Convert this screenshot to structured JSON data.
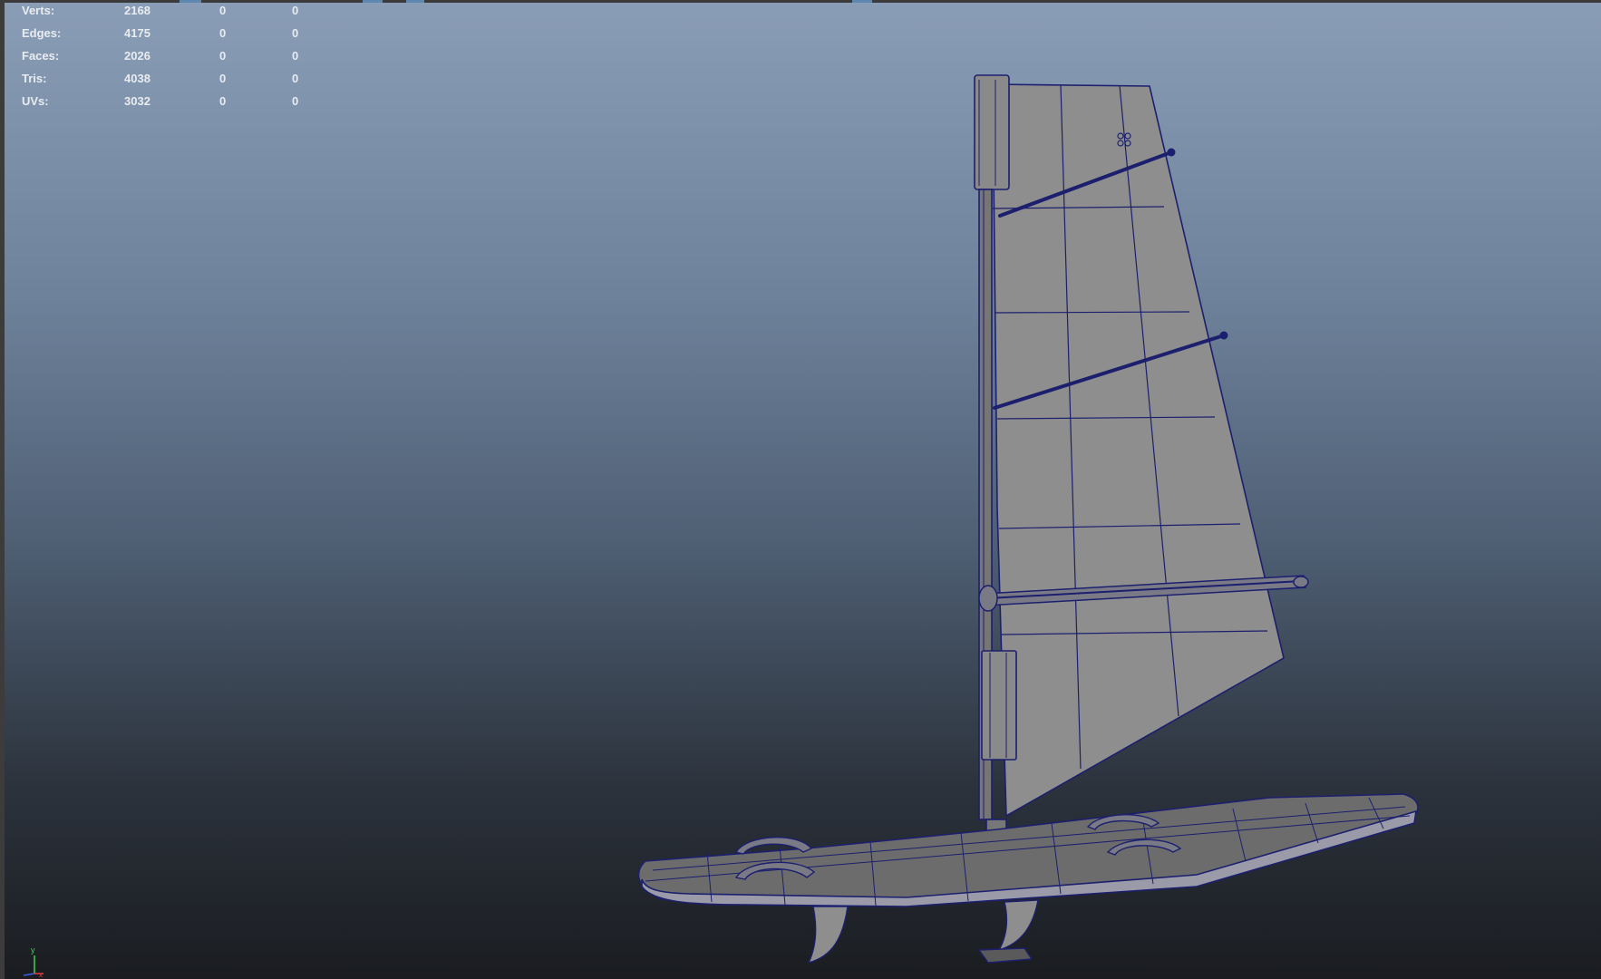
{
  "hud": {
    "rows": [
      {
        "label": "Verts:",
        "v1": "2168",
        "v2": "0",
        "v3": "0"
      },
      {
        "label": "Edges:",
        "v1": "4175",
        "v2": "0",
        "v3": "0"
      },
      {
        "label": "Faces:",
        "v1": "2026",
        "v2": "0",
        "v3": "0"
      },
      {
        "label": "Tris:",
        "v1": "4038",
        "v2": "0",
        "v3": "0"
      },
      {
        "label": "UVs:",
        "v1": "3032",
        "v2": "0",
        "v3": "0"
      }
    ]
  },
  "axis": {
    "y_label": "y",
    "x_label": "x"
  },
  "colors": {
    "wire": "#1c1f6e",
    "sail_fill": "#8e8e8e",
    "board_fill": "#6c6c6c",
    "axis_y": "#3fd14a",
    "axis_x": "#e23c3c",
    "axis_z": "#3a62e6"
  },
  "scene": {
    "model": "windsurf-board",
    "parts": [
      "sail",
      "mast",
      "boom",
      "battens",
      "board",
      "foot-straps",
      "fins"
    ]
  }
}
